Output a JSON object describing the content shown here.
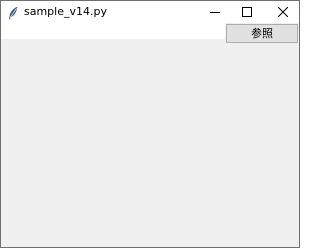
{
  "window": {
    "title": "sample_v14.py",
    "icon": "feather-icon"
  },
  "controls": {
    "minimize_icon": "minimize-icon",
    "maximize_icon": "maximize-icon",
    "close_icon": "close-icon"
  },
  "form": {
    "path_value": "",
    "browse_label": "参照"
  },
  "colors": {
    "window_bg": "#f0f0f0",
    "titlebar_bg": "#ffffff",
    "button_bg": "#e1e1e1",
    "button_border": "#adadad"
  }
}
